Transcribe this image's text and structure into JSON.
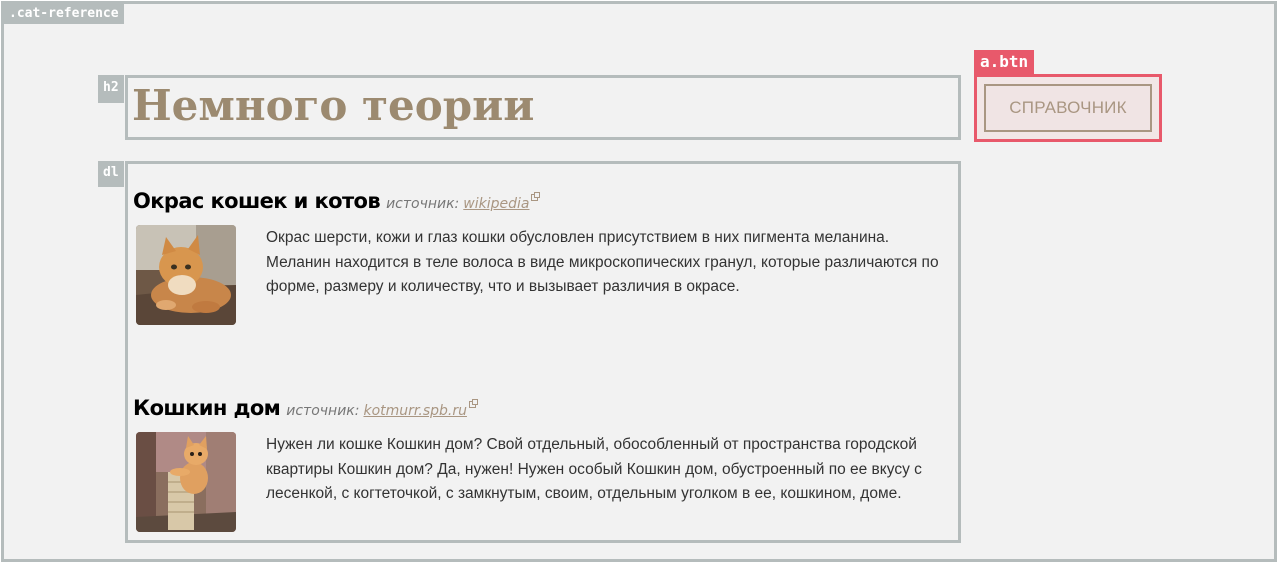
{
  "debug_tags": {
    "outer": ".cat-reference",
    "h2": "h2",
    "dl": "dl",
    "btn": "a.btn"
  },
  "heading": "Немного теории",
  "button": {
    "label": "СПРАВОЧНИК"
  },
  "entries": [
    {
      "title": "Окрас кошек и котов",
      "source_label": "источник:",
      "source_link": "wikipedia",
      "image": "cat-photo",
      "description": "Окрас шерсти, кожи и глаз кошки обусловлен присутствием в них пигмента меланина. Меланин находится в теле волоса в виде микроскопических гранул, которые различаются по форме, размеру и количеству, что и вызывает различия в окрасе."
    },
    {
      "title": "Кошкин дом",
      "source_label": "источник:",
      "source_link": "kotmurr.spb.ru",
      "image": "kitten-scratching-post-photo",
      "description": "Нужен ли кошке Кошкин дом? Свой отдельный, обособленный от пространства городской квартиры Кошкин дом? Да, нужен! Нужен особый Кошкин дом, обустроенный по ее вкусу с лесенкой, с когтеточкой, с замкнутым, своим, отдельным уголком в ее, кошкином, доме."
    }
  ],
  "colors": {
    "heading": "#9c8a70",
    "link": "#a99682",
    "debug_gray": "#b5bcbc",
    "debug_red": "#e8596b",
    "background": "#f2f2f2"
  }
}
